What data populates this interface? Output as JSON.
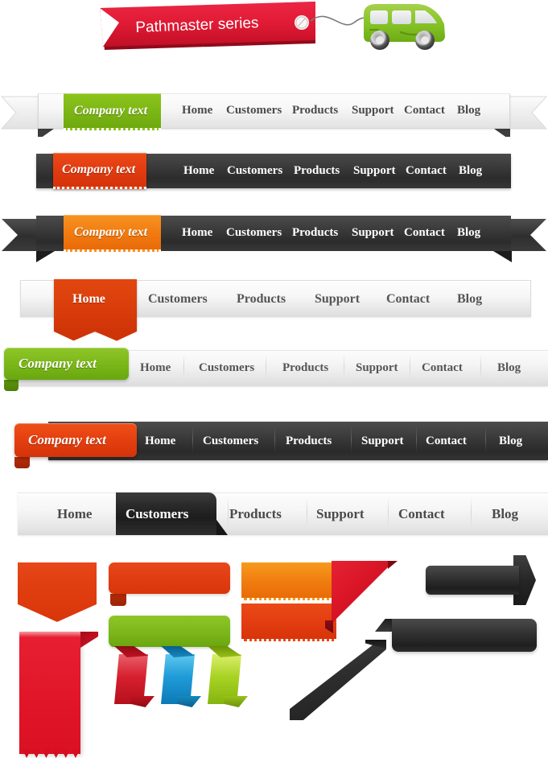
{
  "banner": {
    "title": "Pathmaster series",
    "icons": [
      "luggage-tag-icon",
      "green-van-icon"
    ],
    "colors": {
      "tag": "#e1203a",
      "van": "#8cc63e"
    }
  },
  "nav_items": [
    "Home",
    "Customers",
    "Products",
    "Support",
    "Contact",
    "Blog"
  ],
  "bars": [
    {
      "id": "bar-1",
      "style": "light-ribbon",
      "brand_label": "Company text",
      "brand_color": "#7fb916",
      "bar_color": "#f2f2f2",
      "text_color": "#4a4a4a",
      "items": [
        "Home",
        "Customers",
        "Products",
        "Support",
        "Contact",
        "Blog"
      ],
      "active": null
    },
    {
      "id": "bar-2",
      "style": "dark-flat",
      "brand_label": "Company text",
      "brand_color": "#e23c10",
      "bar_color": "#333333",
      "text_color": "#ffffff",
      "items": [
        "Home",
        "Customers",
        "Products",
        "Support",
        "Contact",
        "Blog"
      ],
      "active": null
    },
    {
      "id": "bar-3",
      "style": "dark-ribbon",
      "brand_label": "Company text",
      "brand_color": "#f17c12",
      "bar_color": "#323232",
      "text_color": "#ffffff",
      "items": [
        "Home",
        "Customers",
        "Products",
        "Support",
        "Contact",
        "Blog"
      ],
      "active": null
    },
    {
      "id": "bar-4",
      "style": "light-bookmark",
      "brand_label": null,
      "brand_color": null,
      "bar_color": "#efefef",
      "text_color": "#4a4a4a",
      "items": [
        "Home",
        "Customers",
        "Products",
        "Support",
        "Contact",
        "Blog"
      ],
      "active": "Home",
      "active_color": "#da3d0b"
    },
    {
      "id": "bar-5",
      "style": "light-rounded-tab",
      "brand_label": "Company text",
      "brand_color": "#7cb81a",
      "bar_color": "#ececec",
      "text_color": "#555555",
      "items": [
        "Home",
        "Customers",
        "Products",
        "Support",
        "Contact",
        "Blog"
      ],
      "active": null
    },
    {
      "id": "bar-6",
      "style": "dark-rounded-tab",
      "brand_label": "Company text",
      "brand_color": "#e43f10",
      "bar_color": "#333333",
      "text_color": "#ffffff",
      "items": [
        "Home",
        "Customers",
        "Products",
        "Support",
        "Contact",
        "Blog"
      ],
      "active": null
    },
    {
      "id": "bar-7",
      "style": "light-dark-active-tab",
      "brand_label": null,
      "brand_color": null,
      "bar_color": "#efefef",
      "text_color": "#4a4a4a",
      "items": [
        "Home",
        "Customers",
        "Products",
        "Support",
        "Contact",
        "Blog"
      ],
      "active": "Customers",
      "active_color": "#232323"
    }
  ],
  "shapes": [
    {
      "name": "bookmark-ribbon-red",
      "color": "#e03f12"
    },
    {
      "name": "zigzag-banner-red",
      "color": "#e01528"
    },
    {
      "name": "speech-bubble-red",
      "color": "#df3d11"
    },
    {
      "name": "speech-bubble-green",
      "color": "#7bb71a"
    },
    {
      "name": "perforated-stamp-orange",
      "color": "#f07c10"
    },
    {
      "name": "perforated-stamp-red",
      "color": "#e23d10"
    },
    {
      "name": "folded-ribbon-red",
      "color": "#d6202f"
    },
    {
      "name": "folded-ribbon-blue",
      "color": "#1f9cd8"
    },
    {
      "name": "folded-ribbon-green",
      "color": "#a8d323"
    },
    {
      "name": "corner-flag-red",
      "color": "#d41122"
    },
    {
      "name": "arrow-banner-dark",
      "color": "#2c2c2c"
    },
    {
      "name": "folded-banner-dark",
      "color": "#2d2d2d"
    },
    {
      "name": "diagonal-ribbon-dark",
      "color": "#2e2e2e"
    }
  ]
}
